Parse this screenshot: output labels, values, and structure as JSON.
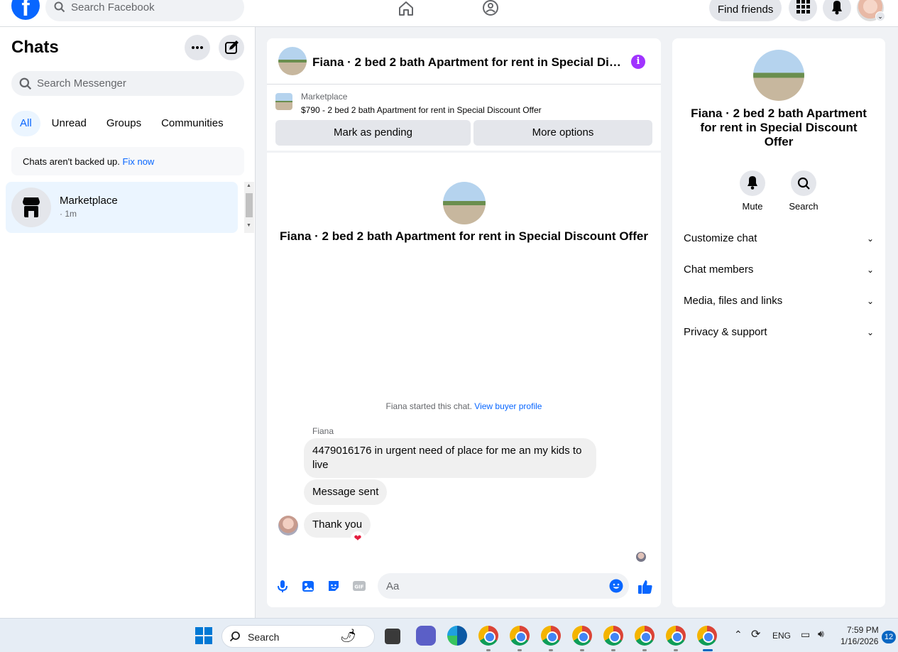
{
  "topbar": {
    "logo": "f",
    "search_placeholder": "Search Facebook",
    "find_friends": "Find friends"
  },
  "sidebar": {
    "title": "Chats",
    "search_placeholder": "Search Messenger",
    "filters": [
      "All",
      "Unread",
      "Groups",
      "Communities"
    ],
    "backup_text": "Chats aren't backed up.",
    "backup_link": "Fix now",
    "chats": [
      {
        "name": "Marketplace",
        "time": "· 1m"
      }
    ]
  },
  "chat": {
    "header_title": "Fiana · 2 bed 2 bath Apartment for rent in Special Discount Offer",
    "info": "i",
    "marketplace_label": "Marketplace",
    "listing": "$790 - 2 bed 2 bath Apartment for rent in Special Discount Offer",
    "mark_pending": "Mark as pending",
    "more_options": "More options",
    "center_title": "Fiana · 2 bed 2 bath Apartment for rent in Special Discount Offer",
    "started_text": "Fiana started this chat.",
    "view_profile": "View buyer profile",
    "sender": "Fiana",
    "messages": [
      "4479016176 in urgent need of place  for me an my kids to live",
      "Message sent",
      "Thank you"
    ],
    "reaction": "❤",
    "composer_placeholder": "Aa"
  },
  "right_panel": {
    "title": "Fiana · 2 bed 2 bath Apartment for rent in Special Discount Offer",
    "actions": [
      "Mute",
      "Search"
    ],
    "rows": [
      "Customize chat",
      "Chat members",
      "Media, files and links",
      "Privacy & support"
    ]
  },
  "taskbar": {
    "search_placeholder": "Search",
    "language": "ENG",
    "time": "7:59 PM",
    "date": "1/16/2026",
    "notifications": "12"
  },
  "colors": {
    "accent": "#0866ff",
    "info_purple": "#a033ff",
    "reaction_red": "#e41e3f"
  }
}
